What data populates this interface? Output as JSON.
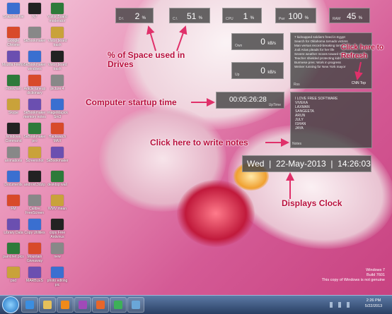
{
  "desktop_icons": [
    [
      "Snapshot file",
      "N7",
      "Vistor Board moderator"
    ],
    [
      "Google Chrome",
      "SkBookmaker",
      "Vistor board trash"
    ],
    [
      "Mozilla Firefox",
      "SkBookmaker windows",
      "Vistor board trash"
    ],
    [
      "Flowchart",
      "Article tuneup dictionary",
      "picture 4"
    ],
    [
      "Skype",
      "SkBookmaker memory notes",
      "ImageMagick Sm3"
    ],
    [
      "Windows Command",
      "SkBookmaker pro",
      "Hackwatch MAX"
    ],
    [
      "animations",
      "Screenshot",
      "SkBookmaker"
    ],
    [
      "Documents",
      "android.3dzip",
      "desktop wall"
    ],
    [
      "FM",
      "Calibre FreeScreen",
      "WMV mean"
    ],
    [
      "Library Data",
      "Copy Utilities",
      "copy Free Antivirus"
    ],
    [
      "paint.net pics",
      "Mountain Giveaway",
      "new"
    ],
    [
      "psd",
      "MARBLES",
      "photo editing pic"
    ]
  ],
  "widgets": {
    "d_drive": {
      "value": "2",
      "unit": "%",
      "label": "D:\\"
    },
    "c_drive": {
      "value": "51",
      "unit": "%",
      "label": "C:\\"
    },
    "cpu": {
      "value": "1",
      "unit": "%",
      "label": "CPU"
    },
    "pwr": {
      "value": "100",
      "unit": "%",
      "label": "Pwr"
    },
    "ram": {
      "value": "45",
      "unit": "%",
      "label": "RAM"
    },
    "down": {
      "value": "0",
      "unit": "kB/s",
      "label": "Own"
    },
    "up": {
      "value": "0",
      "unit": "kB/s",
      "label": "Up"
    },
    "uptime": {
      "value": "00:05:26:28",
      "label": "UpTime"
    },
    "rss": {
      "label": "Rss",
      "button": "CNN Top",
      "items": [
        "7 kidnapped soldiers freed in Egypt",
        "Search for Oklahoma tornado victims",
        "Man versus record-breaking tornado",
        "Jodi Arias pleads for her life",
        "Severe weather moves toward Oklahoma",
        "Teacher shielded protecting kids",
        "Burmese pres: Work in progress",
        "Weiner running for New York mayor"
      ]
    },
    "notes": {
      "label": "Notes",
      "lines": [
        "I LOVE FREE SOFTWARE",
        "VIVEKA",
        "LAXMAN",
        "SANGEETA",
        "ARUN",
        "JULY",
        "ISHAN",
        "JAYA"
      ]
    },
    "clock": {
      "day": "Wed",
      "date": "22-May-2013",
      "time": "14:26:03"
    }
  },
  "annotations": {
    "space": "% of Space used in Drives",
    "refresh": "Click here to Refresh",
    "startup": "Computer startup time",
    "notes": "Click here to write notes",
    "clock": "Displays Clock"
  },
  "watermark": {
    "line1": "Windows 7",
    "line2": "Build 7601",
    "line3": "This copy of Windows is not genuine"
  },
  "taskbar": {
    "time": "2:26 PM",
    "date": "5/22/2013"
  },
  "colors": {
    "annotation": "#b80e3c",
    "widget_bg": "#464646"
  }
}
